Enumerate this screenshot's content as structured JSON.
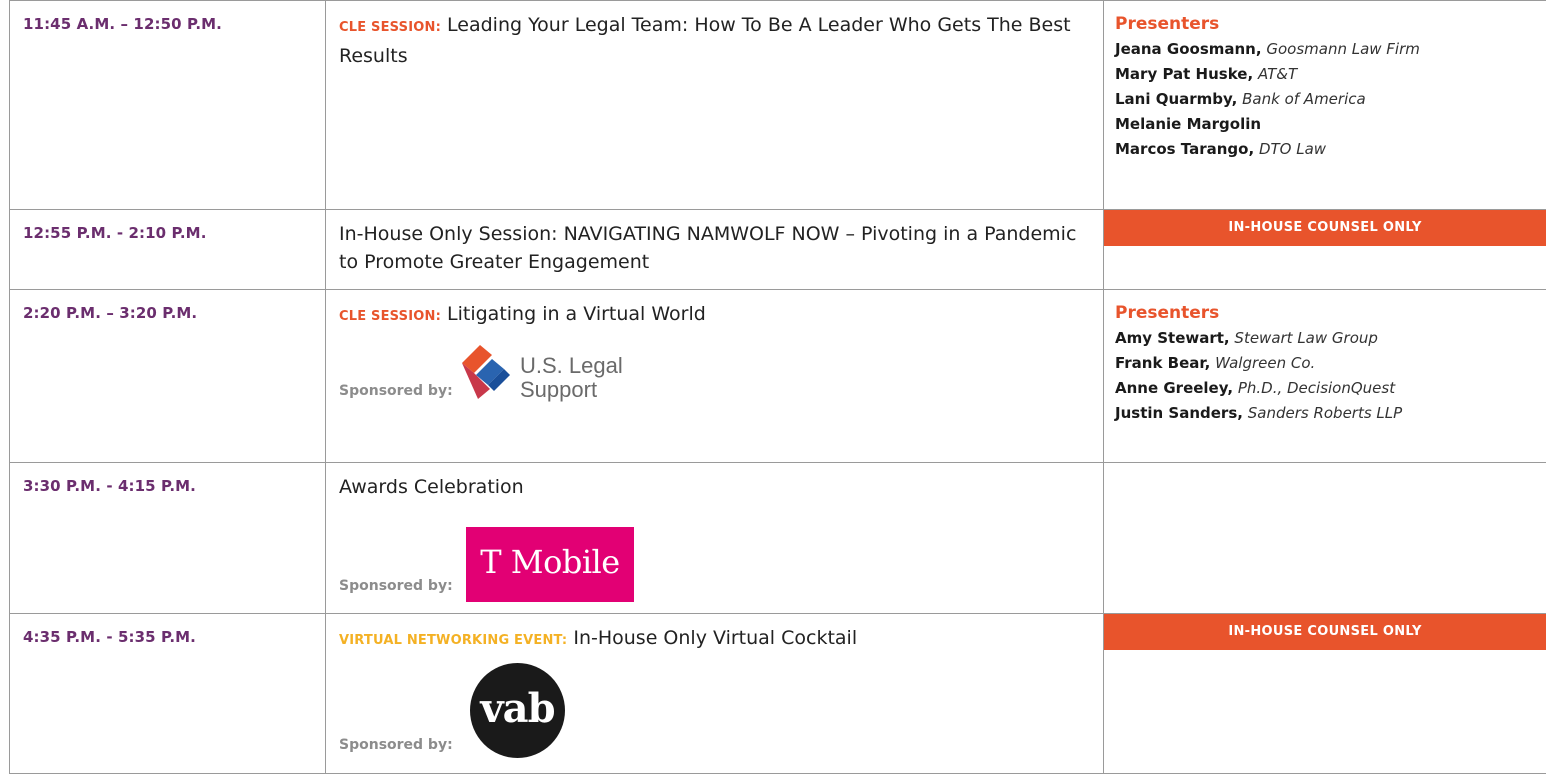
{
  "rows": [
    {
      "time": "11:45 A.M. – 12:50 P.M.",
      "tag": "CLE SESSION:",
      "title": "Leading Your Legal Team: How To Be A Leader Who Gets The Best Results",
      "presenters_heading": "Presenters",
      "presenters": [
        {
          "name": "Jeana Goosmann,",
          "org": "Goosmann Law Firm"
        },
        {
          "name": "Mary Pat Huske,",
          "org": "AT&T"
        },
        {
          "name": "Lani Quarmby,",
          "org": "Bank of America"
        },
        {
          "name": "Melanie Margolin",
          "org": ""
        },
        {
          "name": "Marcos Tarango,",
          "org": "DTO Law"
        }
      ]
    },
    {
      "time": "12:55 P.M. - 2:10 P.M.",
      "title": "In-House Only Session: NAVIGATING NAMWOLF NOW – Pivoting in a Pandemic to Promote Greater Engagement",
      "banner": "IN-HOUSE COUNSEL ONLY"
    },
    {
      "time": "2:20 P.M. – 3:20 P.M.",
      "tag": "CLE SESSION:",
      "title": "Litigating in a Virtual World",
      "sponsor_label": "Sponsored by:",
      "sponsor_logo_text": [
        "U.S. Legal",
        "Support"
      ],
      "presenters_heading": "Presenters",
      "presenters": [
        {
          "name": "Amy Stewart,",
          "org": "Stewart Law Group"
        },
        {
          "name": "Frank Bear,",
          "org": "Walgreen Co."
        },
        {
          "name": "Anne Greeley,",
          "org": "Ph.D., DecisionQuest"
        },
        {
          "name": "Justin Sanders,",
          "org": "Sanders Roberts LLP"
        }
      ]
    },
    {
      "time": "3:30 P.M. - 4:15 P.M.",
      "title": "Awards Celebration",
      "sponsor_label": "Sponsored by:",
      "sponsor_logo_text": "T Mobile"
    },
    {
      "time": "4:35 P.M. - 5:35 P.M.",
      "tag": "VIRTUAL NETWORKING EVENT:",
      "title": "In-House Only Virtual Cocktail",
      "sponsor_label": "Sponsored by:",
      "sponsor_logo_text": "vab",
      "banner": "IN-HOUSE COUNSEL ONLY"
    }
  ],
  "colors": {
    "time": "#6b2e6e",
    "cle_tag": "#e8542c",
    "networking_tag": "#f4b124",
    "banner_bg": "#e8542c",
    "tmobile_bg": "#e20074"
  }
}
